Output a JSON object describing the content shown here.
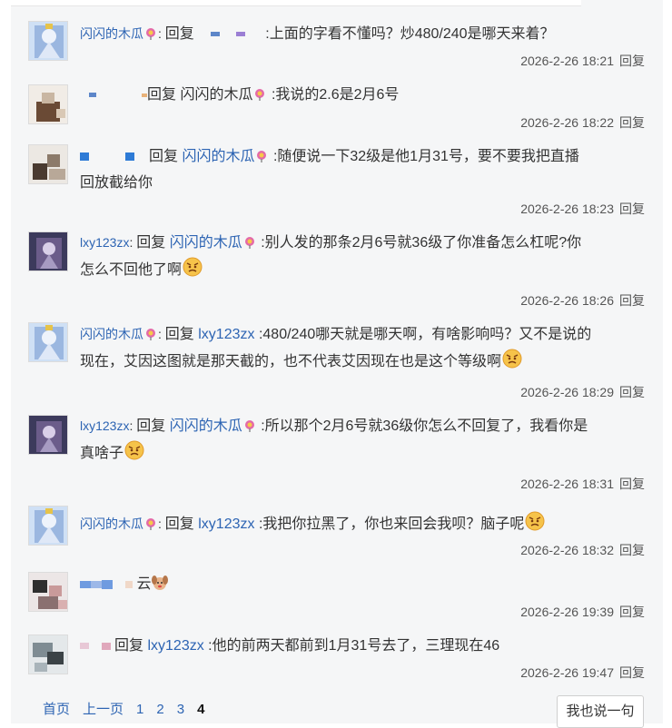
{
  "reply_label": "回复",
  "replies": [
    {
      "user": "闪闪的木瓜",
      "target": "",
      "content": ":上面的字看不懂吗？炒480/240是哪天来着？",
      "time": "2026-2-26 18:21"
    },
    {
      "user": "",
      "target": "闪闪的木瓜",
      "content": ":我说的2.6是2月6号",
      "time": "2026-2-26 18:22"
    },
    {
      "user": "",
      "target": "闪闪的木瓜",
      "content_line1": ":随便说一下32级是他1月31号，要不要我把直播",
      "content_line2": "回放截给你",
      "time": "2026-2-26 18:23"
    },
    {
      "user": "lxy123zx",
      "target": "闪闪的木瓜",
      "content_line1": ":别人发的那条2月6号就36级了你准备怎么杠呢?你",
      "content_line2": "怎么不回他了啊",
      "time": "2026-2-26 18:26"
    },
    {
      "user": "闪闪的木瓜",
      "target": "lxy123zx",
      "content_line1": ":480/240哪天就是哪天啊，有啥影响吗？又不是说的",
      "content_line2": "现在，艾因这图就是那天截的，也不代表艾因现在也是这个等级啊",
      "time": "2026-2-26 18:29"
    },
    {
      "user": "lxy123zx",
      "target": "闪闪的木瓜",
      "content_line1": ":所以那个2月6号就36级你怎么不回复了，我看你是",
      "content_line2": "真啥子",
      "time": "2026-2-26 18:31"
    },
    {
      "user": "闪闪的木瓜",
      "target": "lxy123zx",
      "content": ":我把你拉黑了，你也来回会我呗？脑子呢",
      "time": "2026-2-26 18:32"
    },
    {
      "user": "",
      "target": "",
      "content": "云",
      "time": "2026-2-26 19:39"
    },
    {
      "user": "",
      "target": "lxy123zx",
      "content": ":他的前两天都前到1月31号去了，三理现在46",
      "time": "2026-2-26 19:47"
    }
  ],
  "pager": {
    "first": "首页",
    "prev": "上一页",
    "p1": "1",
    "p2": "2",
    "p3": "3",
    "p4": "4"
  },
  "post_button": "我也说一句",
  "colors": {
    "link": "#2d64b3",
    "panel": "#f5f6f7"
  }
}
